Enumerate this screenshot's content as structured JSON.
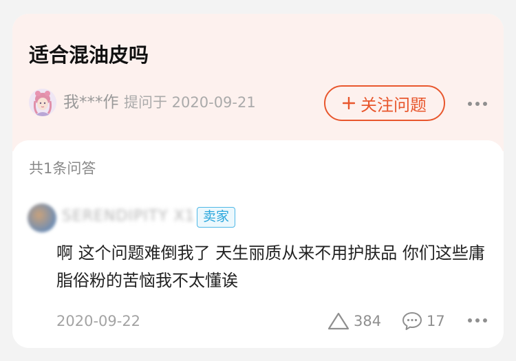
{
  "question": {
    "title": "适合混油皮吗",
    "asker_name": "我***作",
    "asked_on": "提问于 2020-09-21",
    "follow_label": "关注问题"
  },
  "answers": {
    "count_label": "共1条问答",
    "items": [
      {
        "author": "SERENDIPITY X1",
        "badge": "卖家",
        "text": "啊 这个问题难倒我了 天生丽质从来不用护肤品 你们这些庸脂俗粉的苦恼我不太懂诶",
        "date": "2020-09-22",
        "likes": "384",
        "comments": "17"
      }
    ]
  },
  "colors": {
    "accent": "#e8562c",
    "question_bg": "#fdf1ee",
    "badge": "#2aa6dc"
  },
  "icons": [
    "plus-icon",
    "more-icon",
    "like-icon",
    "comment-icon",
    "avatar"
  ]
}
